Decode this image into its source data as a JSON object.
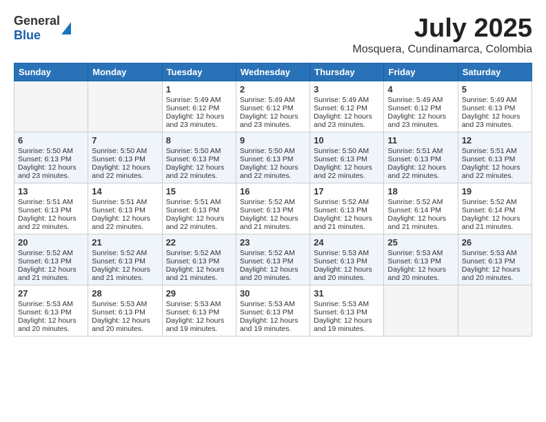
{
  "logo": {
    "line1": "General",
    "line2": "Blue"
  },
  "title": "July 2025",
  "subtitle": "Mosquera, Cundinamarca, Colombia",
  "days_of_week": [
    "Sunday",
    "Monday",
    "Tuesday",
    "Wednesday",
    "Thursday",
    "Friday",
    "Saturday"
  ],
  "weeks": [
    [
      {
        "day": "",
        "sunrise": "",
        "sunset": "",
        "daylight": "",
        "empty": true
      },
      {
        "day": "",
        "sunrise": "",
        "sunset": "",
        "daylight": "",
        "empty": true
      },
      {
        "day": "1",
        "sunrise": "Sunrise: 5:49 AM",
        "sunset": "Sunset: 6:12 PM",
        "daylight": "Daylight: 12 hours and 23 minutes."
      },
      {
        "day": "2",
        "sunrise": "Sunrise: 5:49 AM",
        "sunset": "Sunset: 6:12 PM",
        "daylight": "Daylight: 12 hours and 23 minutes."
      },
      {
        "day": "3",
        "sunrise": "Sunrise: 5:49 AM",
        "sunset": "Sunset: 6:12 PM",
        "daylight": "Daylight: 12 hours and 23 minutes."
      },
      {
        "day": "4",
        "sunrise": "Sunrise: 5:49 AM",
        "sunset": "Sunset: 6:12 PM",
        "daylight": "Daylight: 12 hours and 23 minutes."
      },
      {
        "day": "5",
        "sunrise": "Sunrise: 5:49 AM",
        "sunset": "Sunset: 6:13 PM",
        "daylight": "Daylight: 12 hours and 23 minutes."
      }
    ],
    [
      {
        "day": "6",
        "sunrise": "Sunrise: 5:50 AM",
        "sunset": "Sunset: 6:13 PM",
        "daylight": "Daylight: 12 hours and 23 minutes."
      },
      {
        "day": "7",
        "sunrise": "Sunrise: 5:50 AM",
        "sunset": "Sunset: 6:13 PM",
        "daylight": "Daylight: 12 hours and 22 minutes."
      },
      {
        "day": "8",
        "sunrise": "Sunrise: 5:50 AM",
        "sunset": "Sunset: 6:13 PM",
        "daylight": "Daylight: 12 hours and 22 minutes."
      },
      {
        "day": "9",
        "sunrise": "Sunrise: 5:50 AM",
        "sunset": "Sunset: 6:13 PM",
        "daylight": "Daylight: 12 hours and 22 minutes."
      },
      {
        "day": "10",
        "sunrise": "Sunrise: 5:50 AM",
        "sunset": "Sunset: 6:13 PM",
        "daylight": "Daylight: 12 hours and 22 minutes."
      },
      {
        "day": "11",
        "sunrise": "Sunrise: 5:51 AM",
        "sunset": "Sunset: 6:13 PM",
        "daylight": "Daylight: 12 hours and 22 minutes."
      },
      {
        "day": "12",
        "sunrise": "Sunrise: 5:51 AM",
        "sunset": "Sunset: 6:13 PM",
        "daylight": "Daylight: 12 hours and 22 minutes."
      }
    ],
    [
      {
        "day": "13",
        "sunrise": "Sunrise: 5:51 AM",
        "sunset": "Sunset: 6:13 PM",
        "daylight": "Daylight: 12 hours and 22 minutes."
      },
      {
        "day": "14",
        "sunrise": "Sunrise: 5:51 AM",
        "sunset": "Sunset: 6:13 PM",
        "daylight": "Daylight: 12 hours and 22 minutes."
      },
      {
        "day": "15",
        "sunrise": "Sunrise: 5:51 AM",
        "sunset": "Sunset: 6:13 PM",
        "daylight": "Daylight: 12 hours and 22 minutes."
      },
      {
        "day": "16",
        "sunrise": "Sunrise: 5:52 AM",
        "sunset": "Sunset: 6:13 PM",
        "daylight": "Daylight: 12 hours and 21 minutes."
      },
      {
        "day": "17",
        "sunrise": "Sunrise: 5:52 AM",
        "sunset": "Sunset: 6:13 PM",
        "daylight": "Daylight: 12 hours and 21 minutes."
      },
      {
        "day": "18",
        "sunrise": "Sunrise: 5:52 AM",
        "sunset": "Sunset: 6:14 PM",
        "daylight": "Daylight: 12 hours and 21 minutes."
      },
      {
        "day": "19",
        "sunrise": "Sunrise: 5:52 AM",
        "sunset": "Sunset: 6:14 PM",
        "daylight": "Daylight: 12 hours and 21 minutes."
      }
    ],
    [
      {
        "day": "20",
        "sunrise": "Sunrise: 5:52 AM",
        "sunset": "Sunset: 6:13 PM",
        "daylight": "Daylight: 12 hours and 21 minutes."
      },
      {
        "day": "21",
        "sunrise": "Sunrise: 5:52 AM",
        "sunset": "Sunset: 6:13 PM",
        "daylight": "Daylight: 12 hours and 21 minutes."
      },
      {
        "day": "22",
        "sunrise": "Sunrise: 5:52 AM",
        "sunset": "Sunset: 6:13 PM",
        "daylight": "Daylight: 12 hours and 21 minutes."
      },
      {
        "day": "23",
        "sunrise": "Sunrise: 5:52 AM",
        "sunset": "Sunset: 6:13 PM",
        "daylight": "Daylight: 12 hours and 20 minutes."
      },
      {
        "day": "24",
        "sunrise": "Sunrise: 5:53 AM",
        "sunset": "Sunset: 6:13 PM",
        "daylight": "Daylight: 12 hours and 20 minutes."
      },
      {
        "day": "25",
        "sunrise": "Sunrise: 5:53 AM",
        "sunset": "Sunset: 6:13 PM",
        "daylight": "Daylight: 12 hours and 20 minutes."
      },
      {
        "day": "26",
        "sunrise": "Sunrise: 5:53 AM",
        "sunset": "Sunset: 6:13 PM",
        "daylight": "Daylight: 12 hours and 20 minutes."
      }
    ],
    [
      {
        "day": "27",
        "sunrise": "Sunrise: 5:53 AM",
        "sunset": "Sunset: 6:13 PM",
        "daylight": "Daylight: 12 hours and 20 minutes."
      },
      {
        "day": "28",
        "sunrise": "Sunrise: 5:53 AM",
        "sunset": "Sunset: 6:13 PM",
        "daylight": "Daylight: 12 hours and 20 minutes."
      },
      {
        "day": "29",
        "sunrise": "Sunrise: 5:53 AM",
        "sunset": "Sunset: 6:13 PM",
        "daylight": "Daylight: 12 hours and 19 minutes."
      },
      {
        "day": "30",
        "sunrise": "Sunrise: 5:53 AM",
        "sunset": "Sunset: 6:13 PM",
        "daylight": "Daylight: 12 hours and 19 minutes."
      },
      {
        "day": "31",
        "sunrise": "Sunrise: 5:53 AM",
        "sunset": "Sunset: 6:13 PM",
        "daylight": "Daylight: 12 hours and 19 minutes."
      },
      {
        "day": "",
        "sunrise": "",
        "sunset": "",
        "daylight": "",
        "empty": true
      },
      {
        "day": "",
        "sunrise": "",
        "sunset": "",
        "daylight": "",
        "empty": true
      }
    ]
  ]
}
